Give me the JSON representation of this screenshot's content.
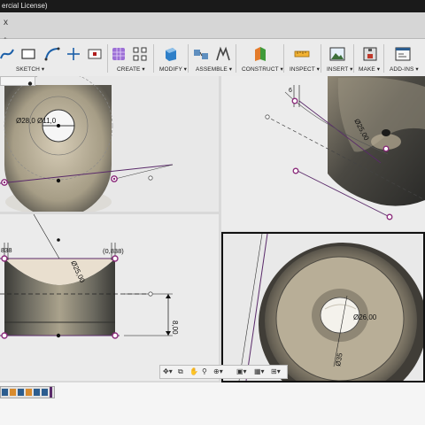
{
  "window": {
    "title_fragment": "ercial License)"
  },
  "tabs": {
    "close_glyph": "x",
    "new_tab_glyph": "+"
  },
  "toolbar": {
    "groups": [
      {
        "label": "SKETCH ▾"
      },
      {
        "label": "CREATE ▾"
      },
      {
        "label": "MODIFY ▾"
      },
      {
        "label": "ASSEMBLE ▾"
      },
      {
        "label": "CONSTRUCT ▾"
      },
      {
        "label": "INSPECT ▾"
      },
      {
        "label": "INSERT ▾"
      },
      {
        "label": "MAKE ▾"
      },
      {
        "label": "ADD-INS ▾"
      }
    ]
  },
  "viewports": {
    "top_left": {
      "dimension_label": "Ø28,0 Ø11,0"
    },
    "top_right": {
      "dimension_label": "Ø25,00",
      "small_label": "6"
    },
    "bottom_left": {
      "dimension_label": "Ø25,00",
      "left_label": "838",
      "right_label": "(0,838)",
      "height_label": "8,00"
    },
    "bottom_right": {
      "inner_dimension": "Ø26,00",
      "outer_dimension": "Ø35"
    }
  },
  "colors": {
    "sketch_point": "#8a2a7a",
    "sketch_line": "#5a2a6a",
    "part_dark": "#3e3e3a",
    "part_mid": "#7a7568",
    "part_light": "#c9c1ae",
    "toolbar_bg": "#ebebeb",
    "viewport_bg": "#e8e8e8"
  }
}
